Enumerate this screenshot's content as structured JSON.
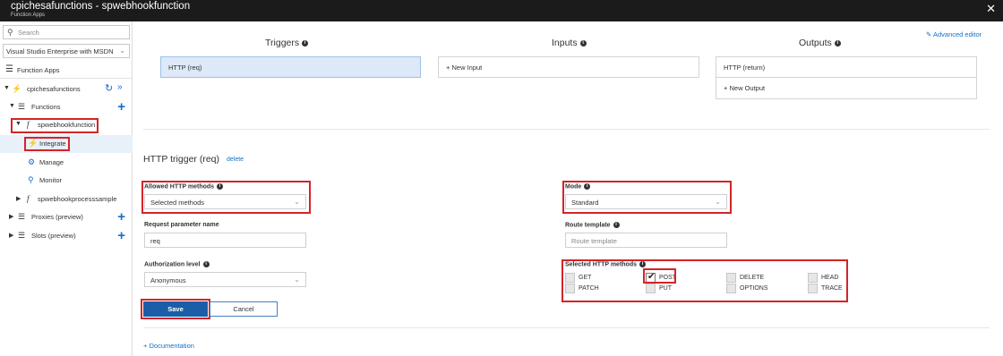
{
  "window": {
    "title": "cpichesafunctions - spwebhookfunction",
    "subtitle": "Function Apps",
    "close_glyph": "✕"
  },
  "sidebar": {
    "search_placeholder": "Search",
    "subscription": "Visual Studio Enterprise with MSDN",
    "function_apps_label": "Function Apps",
    "tree": {
      "app": "cpichesafunctions",
      "functions": "Functions",
      "function": "spwebhookfunction",
      "integrate": "Integrate",
      "manage": "Manage",
      "monitor": "Monitor",
      "other_function": "spwebhookprocesssample",
      "proxies": "Proxies (preview)",
      "slots": "Slots (preview)"
    }
  },
  "main": {
    "advanced_editor": "Advanced editor",
    "columns": {
      "triggers": {
        "title": "Triggers",
        "items": [
          "HTTP (req)"
        ]
      },
      "inputs": {
        "title": "Inputs",
        "new_label": "New Input"
      },
      "outputs": {
        "title": "Outputs",
        "items": [
          "HTTP (return)"
        ],
        "new_label": "New Output"
      }
    },
    "trigger_section": {
      "title": "HTTP trigger (req)",
      "delete_label": "delete"
    },
    "form": {
      "allowed_methods": {
        "label": "Allowed HTTP methods",
        "value": "Selected methods"
      },
      "request_param": {
        "label": "Request parameter name",
        "value": "req"
      },
      "auth_level": {
        "label": "Authorization level",
        "value": "Anonymous"
      },
      "mode": {
        "label": "Mode",
        "value": "Standard"
      },
      "route_template": {
        "label": "Route template",
        "placeholder": "Route template"
      },
      "selected_methods": {
        "label": "Selected HTTP methods",
        "options": [
          {
            "name": "GET",
            "checked": false
          },
          {
            "name": "POST",
            "checked": true
          },
          {
            "name": "DELETE",
            "checked": false
          },
          {
            "name": "HEAD",
            "checked": false
          },
          {
            "name": "PATCH",
            "checked": false
          },
          {
            "name": "PUT",
            "checked": false
          },
          {
            "name": "OPTIONS",
            "checked": false
          },
          {
            "name": "TRACE",
            "checked": false
          }
        ]
      }
    },
    "save_label": "Save",
    "cancel_label": "Cancel",
    "documentation": "Documentation"
  },
  "colors": {
    "accent": "#1470c6",
    "highlight_box": "#d32428",
    "titlebar": "#1b1b1b",
    "save_button": "#1b5ea8"
  },
  "icons": [
    "search-icon",
    "chevron-down-icon",
    "list-icon",
    "lightning-icon",
    "gear-icon",
    "magnifier-icon",
    "function-icon",
    "plus-icon",
    "refresh-icon",
    "double-chevron-icon",
    "info-icon",
    "edit-icon",
    "close-icon",
    "checkmark-icon"
  ]
}
